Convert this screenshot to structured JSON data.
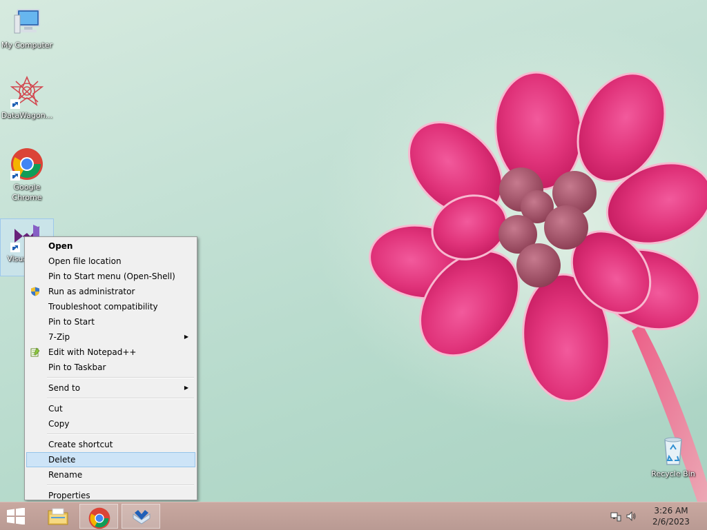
{
  "desktop": {
    "icons": [
      {
        "label": "My Computer",
        "icon": "computer-icon"
      },
      {
        "label": "DataWagon...",
        "icon": "datawagon-icon"
      },
      {
        "label": "Google Chrome",
        "icon": "chrome-icon"
      },
      {
        "label": "Visual ... 2",
        "icon": "visual-studio-icon"
      },
      {
        "label": "Recycle Bin",
        "icon": "recycle-bin-icon"
      }
    ]
  },
  "context_menu": {
    "items": [
      {
        "label": "Open"
      },
      {
        "label": "Open file location"
      },
      {
        "label": "Pin to Start menu (Open-Shell)"
      },
      {
        "label": "Run as administrator",
        "icon": "uac-shield-icon"
      },
      {
        "label": "Troubleshoot compatibility"
      },
      {
        "label": "Pin to Start"
      },
      {
        "label": "7-Zip",
        "submenu": true
      },
      {
        "label": "Edit with Notepad++",
        "icon": "notepad-plus-plus-icon"
      },
      {
        "label": "Pin to Taskbar"
      },
      {
        "label": "Send to",
        "submenu": true
      },
      {
        "label": "Cut"
      },
      {
        "label": "Copy"
      },
      {
        "label": "Create shortcut"
      },
      {
        "label": "Delete"
      },
      {
        "label": "Rename"
      },
      {
        "label": "Properties"
      }
    ],
    "highlighted": "Delete"
  },
  "taskbar": {
    "pinned": [
      {
        "name": "file-explorer",
        "icon": "folder-icon"
      },
      {
        "name": "chrome",
        "icon": "chrome-icon"
      },
      {
        "name": "app",
        "icon": "app-icon"
      }
    ],
    "clock": {
      "time": "3:26 AM",
      "date": "2/6/2023"
    }
  },
  "colors": {
    "menu_bg": "#f0f0f0",
    "menu_highlight": "#cde4f7",
    "taskbar": "#c3a39c"
  }
}
